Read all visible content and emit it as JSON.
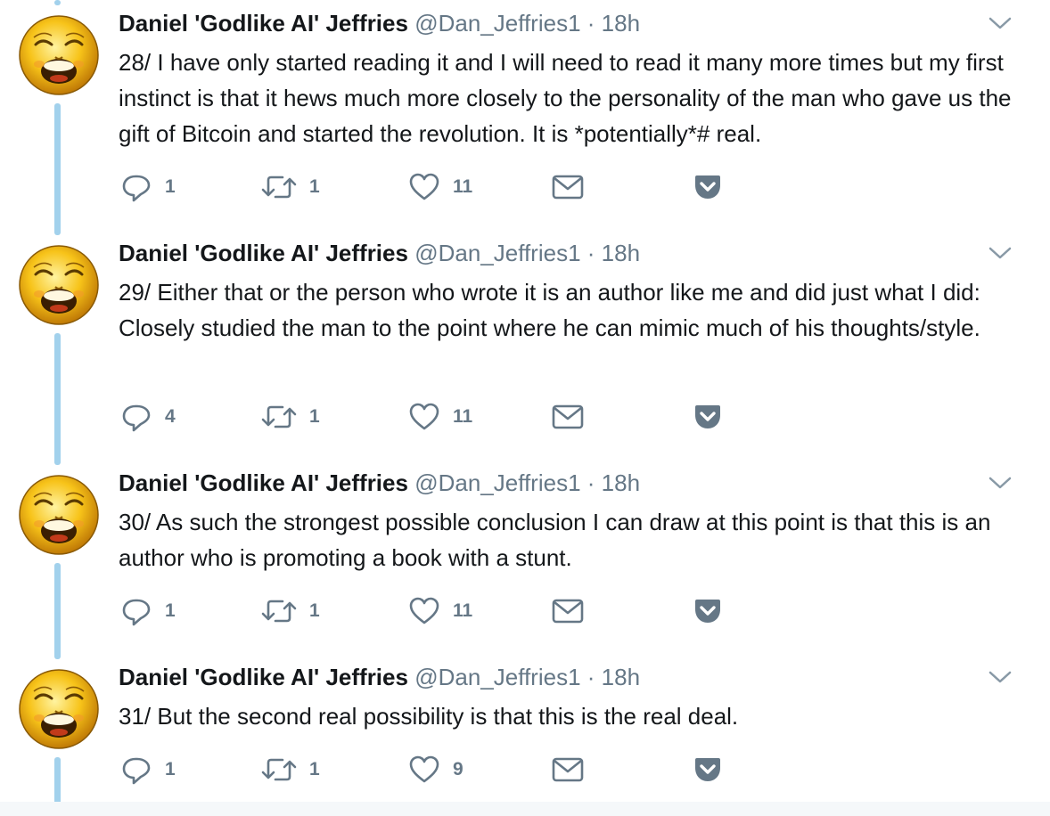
{
  "tweets": [
    {
      "name": "Daniel 'Godlike AI' Jeffries",
      "handle": "@Dan_Jeffries1",
      "dot": "·",
      "time": "18h",
      "text": "28/ I have only started reading it and I will need to read it many more times but my first instinct is that it hews much more closely to the personality of the man who gave us the gift of Bitcoin and started the revolution. It is *potentially*# real.",
      "replies": "1",
      "retweets": "1",
      "likes": "11"
    },
    {
      "name": "Daniel 'Godlike AI' Jeffries",
      "handle": "@Dan_Jeffries1",
      "dot": "·",
      "time": "18h",
      "text": "29/ Either that or the person who wrote it is an author like me and did just what I did: Closely studied the man to the point where he can mimic much of his thoughts/style.",
      "replies": "4",
      "retweets": "1",
      "likes": "11"
    },
    {
      "name": "Daniel 'Godlike AI' Jeffries",
      "handle": "@Dan_Jeffries1",
      "dot": "·",
      "time": "18h",
      "text": "30/ As such the strongest possible conclusion I can draw at this point is that this is an author who is promoting a book with a stunt.",
      "replies": "1",
      "retweets": "1",
      "likes": "11"
    },
    {
      "name": "Daniel 'Godlike AI' Jeffries",
      "handle": "@Dan_Jeffries1",
      "dot": "·",
      "time": "18h",
      "text": "31/ But the second real possibility is that this is the real deal.",
      "replies": "1",
      "retweets": "1",
      "likes": "9"
    }
  ],
  "icons": {
    "reply": "reply-icon",
    "retweet": "retweet-icon",
    "like": "heart-icon",
    "dm": "envelope-icon",
    "pocket": "pocket-icon",
    "more": "chevron-down-icon"
  },
  "colors": {
    "thread_line": "#a2d1ec",
    "secondary_text": "#657786",
    "primary_text": "#14171a",
    "pocket": "#657786"
  }
}
